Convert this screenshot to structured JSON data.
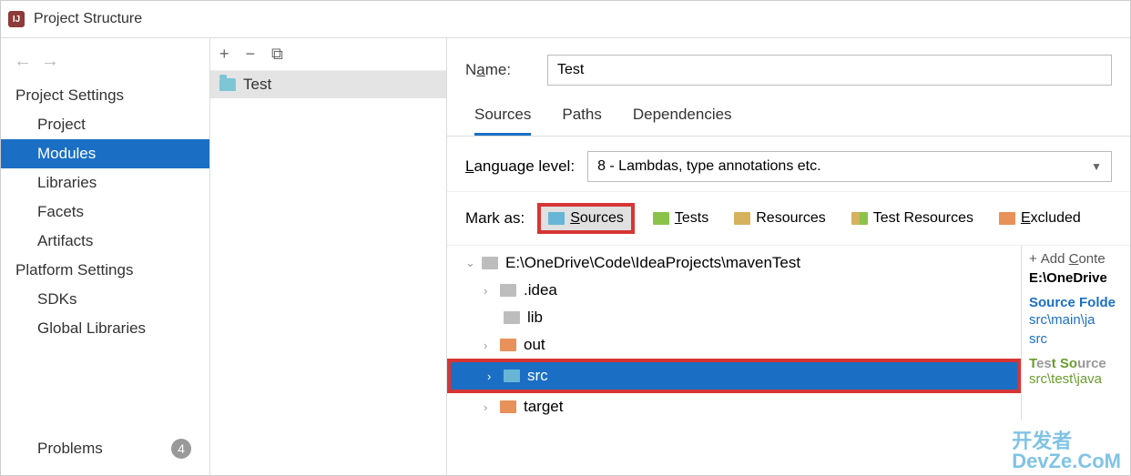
{
  "window": {
    "title": "Project Structure"
  },
  "sidebar": {
    "projectSettings": "Project Settings",
    "items": [
      "Project",
      "Modules",
      "Libraries",
      "Facets",
      "Artifacts"
    ],
    "platformSettings": "Platform Settings",
    "platformItems": [
      "SDKs",
      "Global Libraries"
    ],
    "problems": {
      "label": "Problems",
      "count": "4"
    }
  },
  "modules": {
    "toolbar": {
      "add": "+",
      "remove": "−",
      "copy": "⧉"
    },
    "list": [
      {
        "name": "Test"
      }
    ]
  },
  "details": {
    "nameLabel": "Name:",
    "nameValue": "Test",
    "tabs": [
      "Sources",
      "Paths",
      "Dependencies"
    ],
    "langLabel": "Language level:",
    "langValue": "8 - Lambdas, type annotations etc.",
    "markLabel": "Mark as:",
    "markButtons": {
      "sources": "Sources",
      "tests": "Tests",
      "resources": "Resources",
      "testResources": "Test Resources",
      "excluded": "Excluded"
    },
    "tree": {
      "root": "E:\\OneDrive\\Code\\IdeaProjects\\mavenTest",
      "children": [
        {
          "name": ".idea",
          "color": "gray",
          "exp": "›"
        },
        {
          "name": "lib",
          "color": "gray",
          "exp": ""
        },
        {
          "name": "out",
          "color": "orange",
          "exp": "›"
        },
        {
          "name": "src",
          "color": "blue",
          "exp": "›",
          "selected": true,
          "highlight": true
        },
        {
          "name": "target",
          "color": "orange",
          "exp": "›"
        }
      ]
    },
    "rightPanel": {
      "addContent": "Add Conte",
      "rootPath": "E:\\OneDrive",
      "sourceFolders": "Source Folde",
      "links": [
        "src\\main\\ja",
        "src"
      ],
      "testFolders": "Test Source F",
      "testLinks": [
        "src\\test\\java"
      ]
    }
  },
  "watermark": {
    "line1": "开发者",
    "line2": "DevZe.CoM"
  }
}
